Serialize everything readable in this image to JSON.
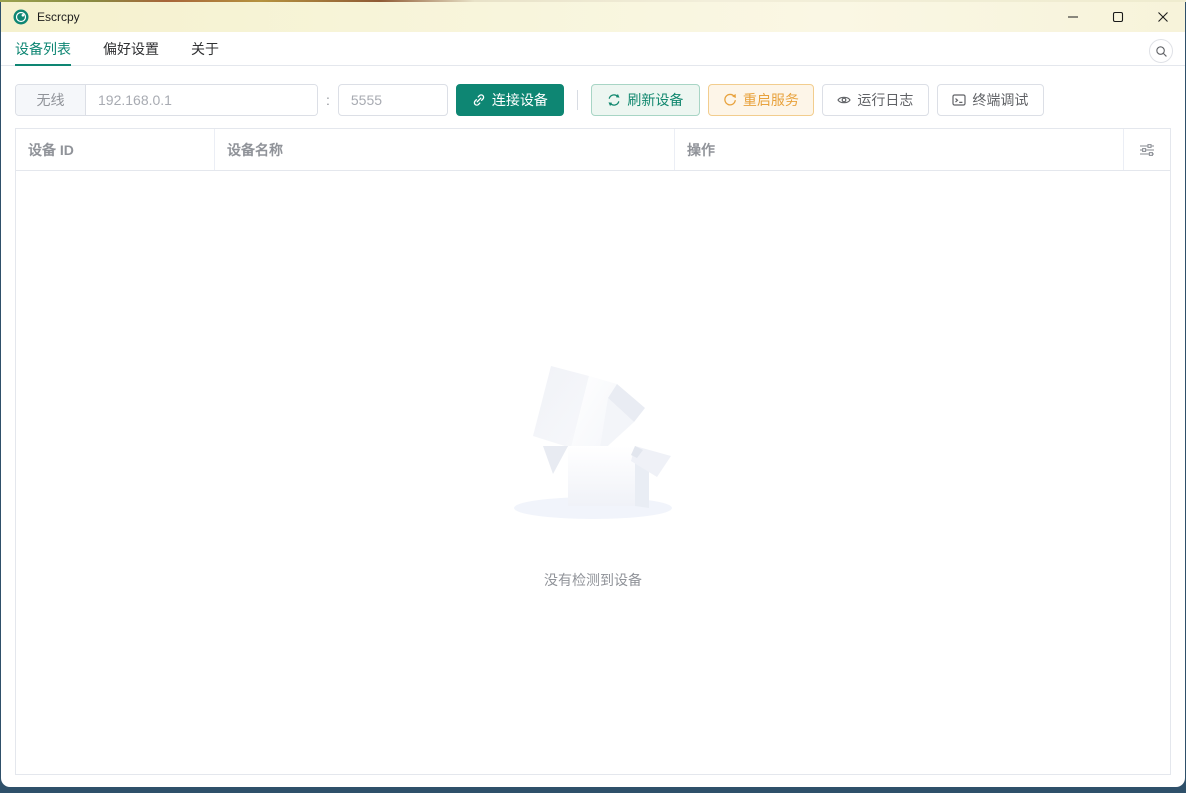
{
  "colors": {
    "primary": "#0e8673",
    "warning": "#e6a23c",
    "titlebar_bg": "#f8f5dd",
    "border": "#dcdfe6",
    "muted_text": "#909399",
    "desktop_bg": "#2f506a"
  },
  "window": {
    "title": "Escrcpy"
  },
  "icons": {
    "app": "escrcpy-logo",
    "search": "magnifier",
    "connect": "link",
    "refresh": "circular-arrows",
    "restart": "refresh-right",
    "logs": "eye",
    "terminal": "terminal-window",
    "column_settings": "sliders",
    "minimize": "minus-line",
    "maximize": "square-outline",
    "close": "x-cross",
    "empty_state": "open-box"
  },
  "tabs": [
    {
      "label": "设备列表",
      "active": true
    },
    {
      "label": "偏好设置",
      "active": false
    },
    {
      "label": "关于",
      "active": false
    }
  ],
  "toolbar": {
    "mode_label": "无线",
    "ip_placeholder": "192.168.0.1",
    "port_separator": ":",
    "port_placeholder": "5555",
    "connect_label": "连接设备",
    "refresh_label": "刷新设备",
    "restart_label": "重启服务",
    "logs_label": "运行日志",
    "terminal_label": "终端调试"
  },
  "device_table": {
    "columns": [
      {
        "label": "设备 ID"
      },
      {
        "label": "设备名称"
      },
      {
        "label": "操作"
      }
    ],
    "rows": [],
    "empty_text": "没有检测到设备"
  }
}
